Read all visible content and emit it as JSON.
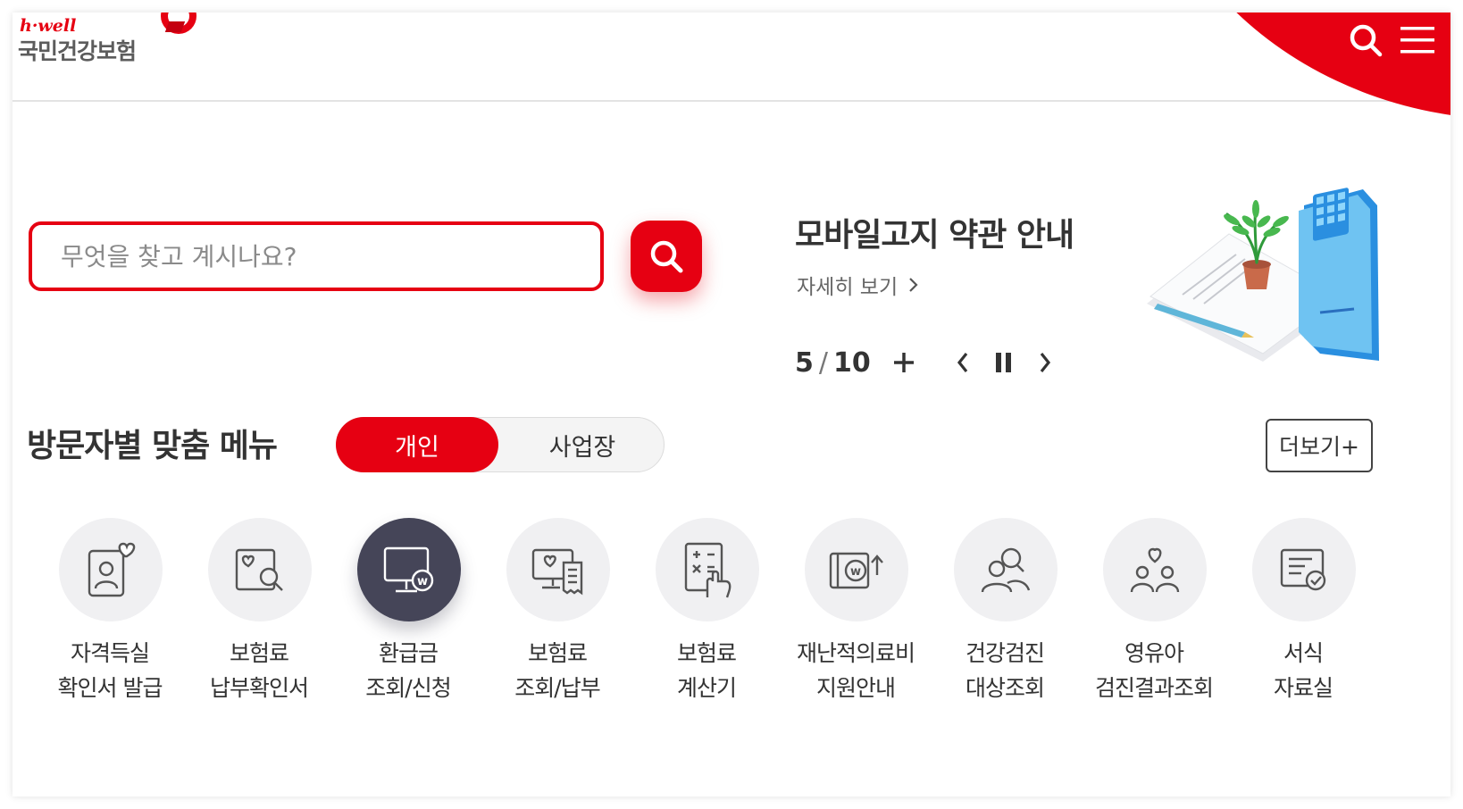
{
  "header": {
    "logo_top": "h·well",
    "logo_main": "국민건강보험",
    "search_icon": "search-icon",
    "menu_icon": "hamburger-icon",
    "accent_color": "#e60012"
  },
  "search": {
    "placeholder": "무엇을 찾고 계시나요?",
    "button_icon": "search-icon"
  },
  "banner": {
    "title": "모바일고지 약관 안내",
    "link": "자세히 보기",
    "pager_current": "5",
    "pager_separator": "/",
    "pager_total": "10",
    "illustration": "phone-plant-document-illustration"
  },
  "visitor_menu": {
    "title": "방문자별 맞춤 메뉴",
    "tabs": [
      {
        "label": "개인",
        "active": true
      },
      {
        "label": "사업장",
        "active": false
      }
    ],
    "more_label": "더보기+",
    "items": [
      {
        "label": "자격득실\n확인서 발급",
        "icon": "id-card-heart-icon",
        "active": false
      },
      {
        "label": "보험료\n납부확인서",
        "icon": "document-search-icon",
        "active": false
      },
      {
        "label": "환급금\n조회/신청",
        "icon": "monitor-won-icon",
        "active": true
      },
      {
        "label": "보험료\n조회/납부",
        "icon": "monitor-receipt-icon",
        "active": false
      },
      {
        "label": "보험료\n계산기",
        "icon": "calculator-hand-icon",
        "active": false
      },
      {
        "label": "재난적의료비\n지원안내",
        "icon": "won-wallet-icon",
        "active": false
      },
      {
        "label": "건강검진\n대상조회",
        "icon": "people-search-icon",
        "active": false
      },
      {
        "label": "영유아\n검진결과조회",
        "icon": "family-heart-icon",
        "active": false
      },
      {
        "label": "서식\n자료실",
        "icon": "form-document-icon",
        "active": false
      }
    ]
  }
}
